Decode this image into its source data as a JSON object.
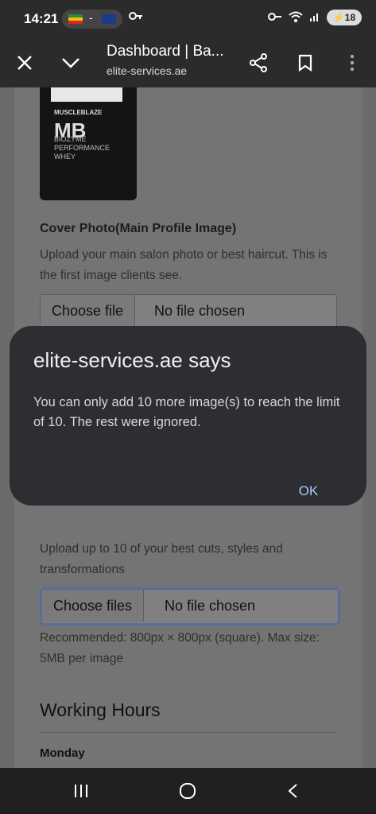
{
  "status": {
    "time": "14:21",
    "dash": "-",
    "battery": "18"
  },
  "toolbar": {
    "title": "Dashboard | Ba...",
    "url": "elite-services.ae"
  },
  "product": {
    "brand": "MUSCLEBLAZE",
    "logo": "MB",
    "line1": "BIOZYME",
    "line2": "PERFORMANCE",
    "line3": "WHEY"
  },
  "cover": {
    "label": "Cover Photo(Main Profile Image)",
    "help": "Upload your main salon photo or best haircut. This is the first image clients see.",
    "choose": "Choose file",
    "chosen": "No file chosen"
  },
  "gallery": {
    "help": "Upload up to 10 of your best cuts, styles and transformations",
    "choose": "Choose files",
    "chosen": "No file chosen",
    "note": "Recommended: 800px × 800px (square). Max size: 5MB per image"
  },
  "hours": {
    "heading": "Working Hours",
    "first_day": "Monday"
  },
  "dialog": {
    "title": "elite-services.ae says",
    "message": "You can only add 10 more image(s) to reach the limit of 10. The rest were ignored.",
    "ok": "OK"
  },
  "colors": {
    "dialog_bg": "#2d2e31",
    "ok_text": "#a8c7fa",
    "bar_bg": "#2b2b2b"
  }
}
